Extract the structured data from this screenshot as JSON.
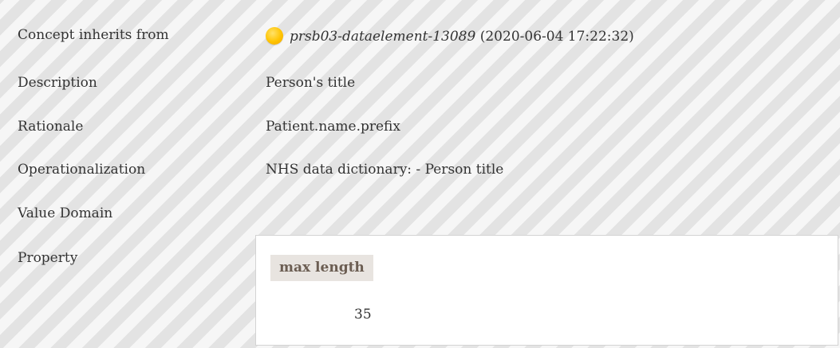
{
  "rows": [
    {
      "label": "Concept inherits from"
    },
    {
      "label": "Description",
      "value": "Person's title"
    },
    {
      "label": "Rationale",
      "value": "Patient.name.prefix"
    },
    {
      "label": "Operationalization",
      "value": "NHS data dictionary: - Person title"
    },
    {
      "label": "Value Domain"
    },
    {
      "label": "Property"
    }
  ],
  "inherits": {
    "status_icon": "status-draft-circle-icon",
    "status_color": "#ffc400",
    "concept_id": "prsb03-dataelement-13089",
    "timestamp": "(2020-06-04 17:22:32)"
  },
  "property": {
    "header": "max length",
    "value": "35"
  }
}
